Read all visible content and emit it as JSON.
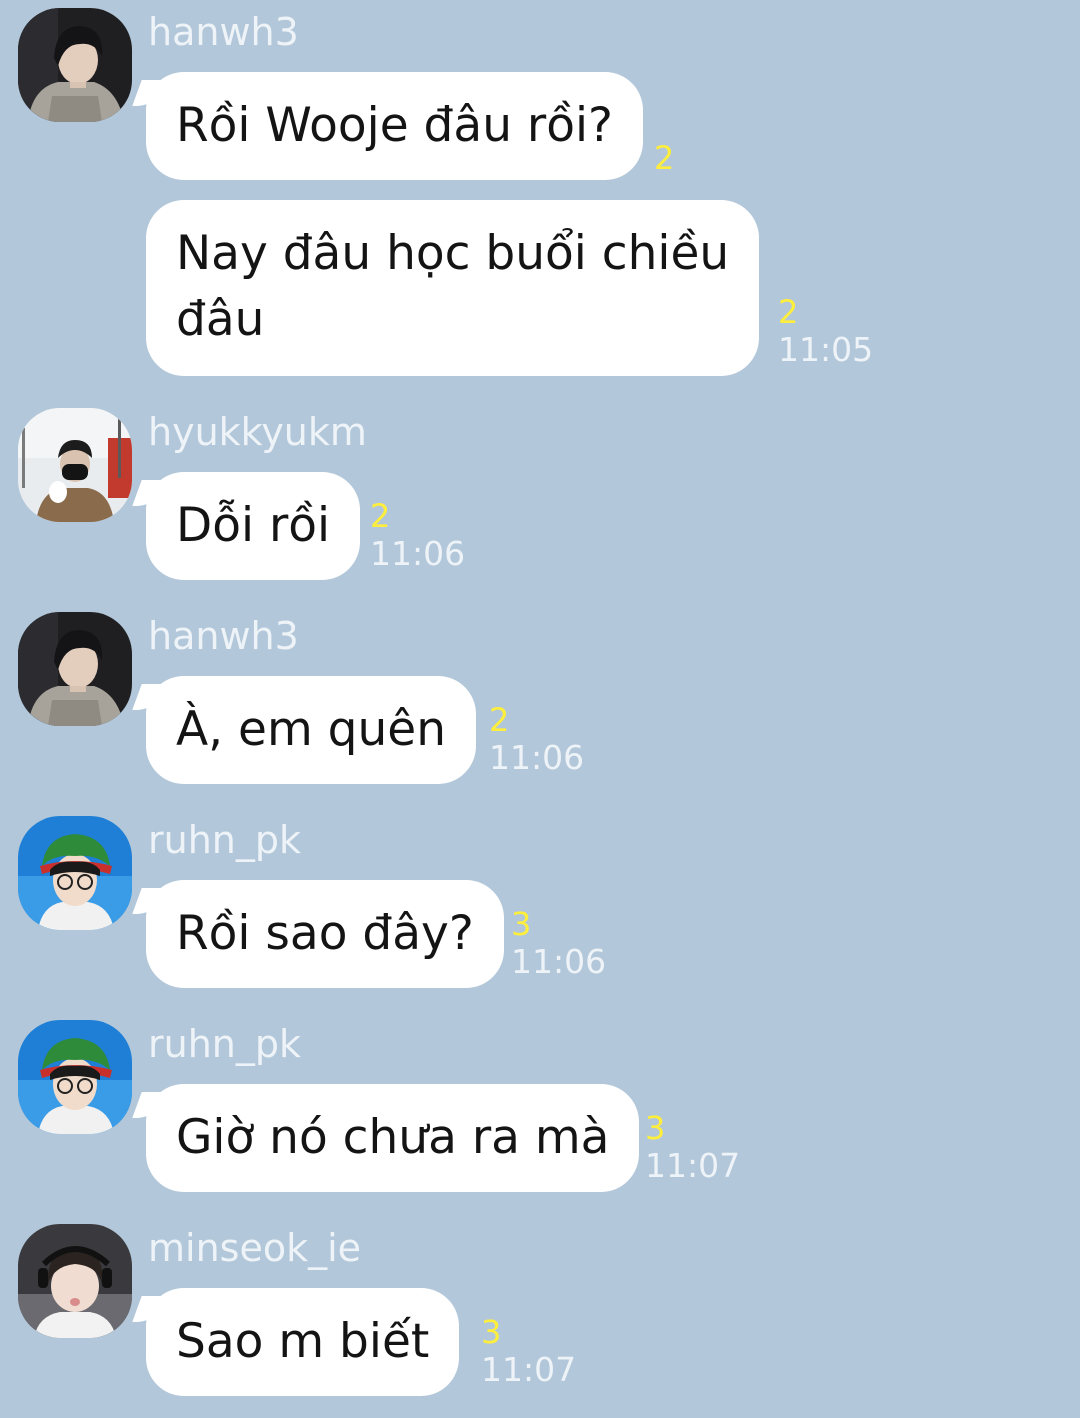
{
  "colors": {
    "background": "#b2c7d9",
    "bubble": "#ffffff",
    "unread": "#ffef3c",
    "muted_text": "#eef3f8"
  },
  "messages": [
    {
      "sender": "hanwh3",
      "avatar": "photo-avatar-dark-hair-hoodie",
      "bubbles": [
        {
          "text": "Rồi Wooje đâu rồi?",
          "unread": "2",
          "time": ""
        },
        {
          "line1": "Nay đâu học buổi chiều",
          "line2": "đâu",
          "unread": "2",
          "time": "11:05"
        }
      ]
    },
    {
      "sender": "hyukkyukm",
      "avatar": "photo-avatar-masked-snow",
      "bubbles": [
        {
          "text": "Dỗi rồi",
          "unread": "2",
          "time": "11:06"
        }
      ]
    },
    {
      "sender": "hanwh3",
      "avatar": "photo-avatar-dark-hair-hoodie",
      "bubbles": [
        {
          "text": "À, em quên",
          "unread": "2",
          "time": "11:06"
        }
      ]
    },
    {
      "sender": "ruhn_pk",
      "avatar": "photo-avatar-green-hat",
      "bubbles": [
        {
          "text": "Rồi sao đây?",
          "unread": "3",
          "time": "11:06"
        }
      ]
    },
    {
      "sender": "ruhn_pk",
      "avatar": "photo-avatar-green-hat",
      "bubbles": [
        {
          "text": "Giờ nó chưa ra mà",
          "unread": "3",
          "time": "11:07"
        }
      ]
    },
    {
      "sender": "minseok_ie",
      "avatar": "photo-avatar-headset",
      "bubbles": [
        {
          "text": "Sao m biết",
          "unread": "3",
          "time": "11:07"
        }
      ]
    }
  ]
}
